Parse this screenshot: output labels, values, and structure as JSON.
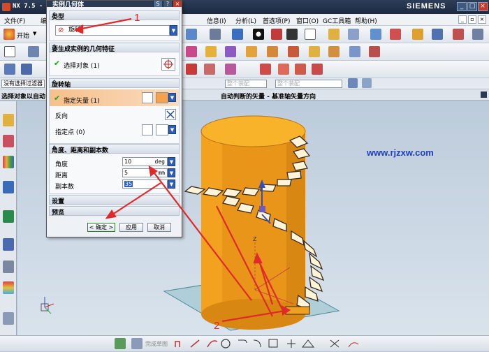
{
  "app": {
    "title": "NX 7.5 -",
    "brand": "SIEMENS"
  },
  "menu": {
    "file": "文件(F)",
    "edit": "编",
    "info": "信息(I)",
    "analysis": "分析(L)",
    "prefs": "首选项(P)",
    "window": "窗口(O)",
    "gc": "GC工具箱",
    "help": "帮助(H)"
  },
  "toolbar": {
    "start": "开始"
  },
  "selection": {
    "filter": "没有选择过滤器",
    "snap1": "整个装配",
    "snap2": "整个装配"
  },
  "cue": {
    "left": "选择对象以自动",
    "center": "自动判断的矢量 - 基准轴矢量方向"
  },
  "dialog": {
    "title": "实例几何体",
    "sec_type": "类型",
    "type_value": "旋转",
    "sec_geom": "要生成实例的几何特征",
    "select_object": "选择对象 (1)",
    "sec_axis": "旋转轴",
    "specify_vector": "指定矢量 (1)",
    "reverse": "反向",
    "specify_point": "指定点 (0)",
    "sec_angle": "角度、距离和副本数",
    "angle_label": "角度",
    "angle_value": "10",
    "angle_unit": "deg",
    "distance_label": "距离",
    "distance_value": "5",
    "distance_unit": "mm",
    "copies_label": "副本数",
    "copies_value": "35",
    "sec_settings": "设置",
    "sec_preview": "预览",
    "ok": "< 确定 >",
    "apply": "应用",
    "cancel": "取消"
  },
  "watermark": "www.rjzxw.com",
  "annotations": {
    "one": "1",
    "two": "2"
  },
  "bottom": {
    "sketch_done": "完成草图"
  },
  "colors": {
    "cylinder": "#f2a21e",
    "accent": "#e02a2a"
  }
}
